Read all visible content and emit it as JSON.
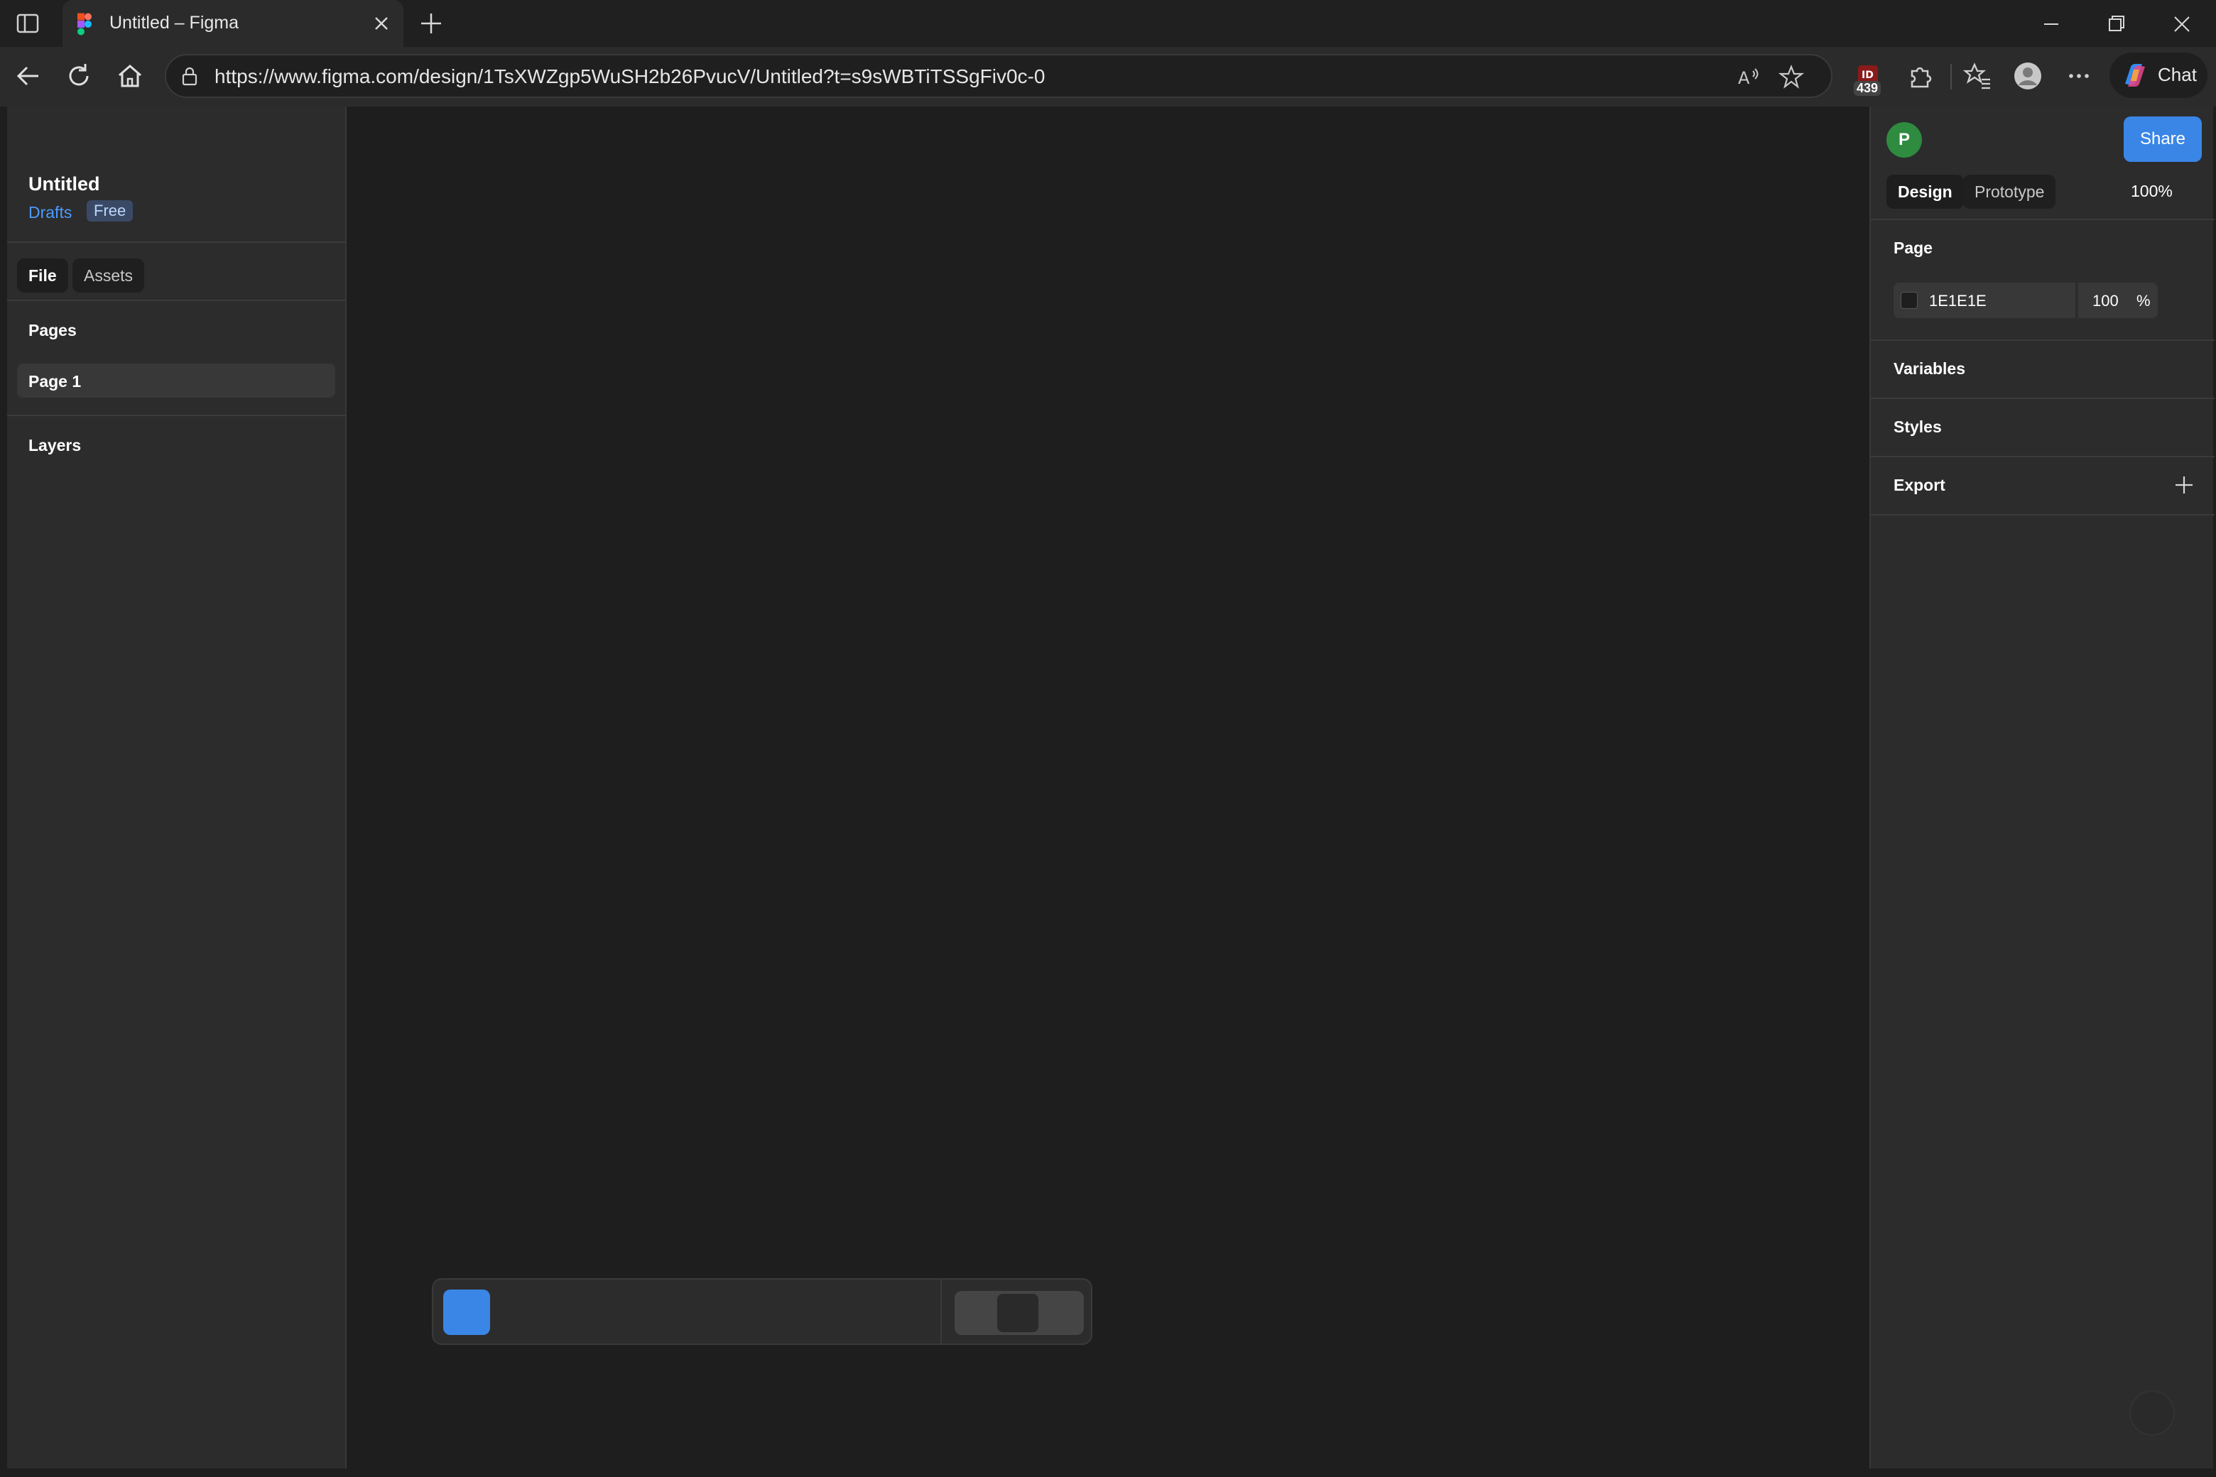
{
  "browser": {
    "tab_title": "Untitled – Figma",
    "url": "https://www.figma.com/design/1TsXWZgp5WuSH2b26PvucV/Untitled?t=s9sWBTiTSSgFiv0c-0",
    "extension_badge_count": "439",
    "chat_label": "Chat"
  },
  "figma": {
    "file_title": "Untitled",
    "location": "Drafts",
    "plan": "Free",
    "left_tabs": [
      "File",
      "Assets"
    ],
    "pages_label": "Pages",
    "pages": [
      "Page 1"
    ],
    "layers_label": "Layers",
    "avatar_initial": "P",
    "share_label": "Share",
    "right_tabs": [
      "Design",
      "Prototype"
    ],
    "zoom": "100%",
    "page_section": {
      "label": "Page",
      "color_hex": "1E1E1E",
      "opacity": "100",
      "opacity_unit": "%"
    },
    "variables_label": "Variables",
    "styles_label": "Styles",
    "export_label": "Export"
  },
  "colors": {
    "accent": "#3a86e6",
    "canvas": "#1e1e1e",
    "panel": "#2c2c2c",
    "avatar": "#2e8b3f",
    "swatch": "#1e1e1e"
  }
}
